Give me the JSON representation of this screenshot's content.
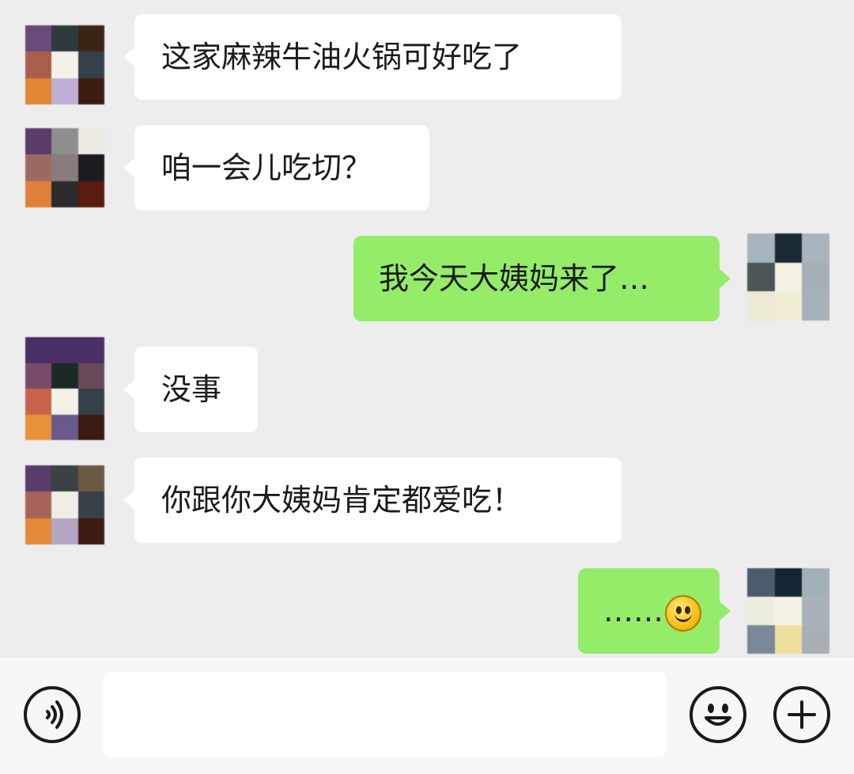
{
  "conversation": {
    "messages": [
      {
        "side": "in",
        "text": "这家麻辣牛油火锅可好吃了"
      },
      {
        "side": "in",
        "text": "咱一会儿吃切？"
      },
      {
        "side": "out",
        "text": "我今天大姨妈来了…"
      },
      {
        "side": "in",
        "text": "没事"
      },
      {
        "side": "in",
        "text": "你跟你大姨妈肯定都爱吃！"
      },
      {
        "side": "out",
        "text": "……",
        "emoji": "smile-emoji"
      }
    ]
  },
  "input_bar": {
    "voice_icon": "voice-icon",
    "emoji_icon": "emoji-icon",
    "add_icon": "plus-icon",
    "input_value": ""
  },
  "colors": {
    "background": "#ededed",
    "incoming_bubble": "#ffffff",
    "outgoing_bubble": "#95ec69",
    "toolbar": "#f7f7f7"
  }
}
